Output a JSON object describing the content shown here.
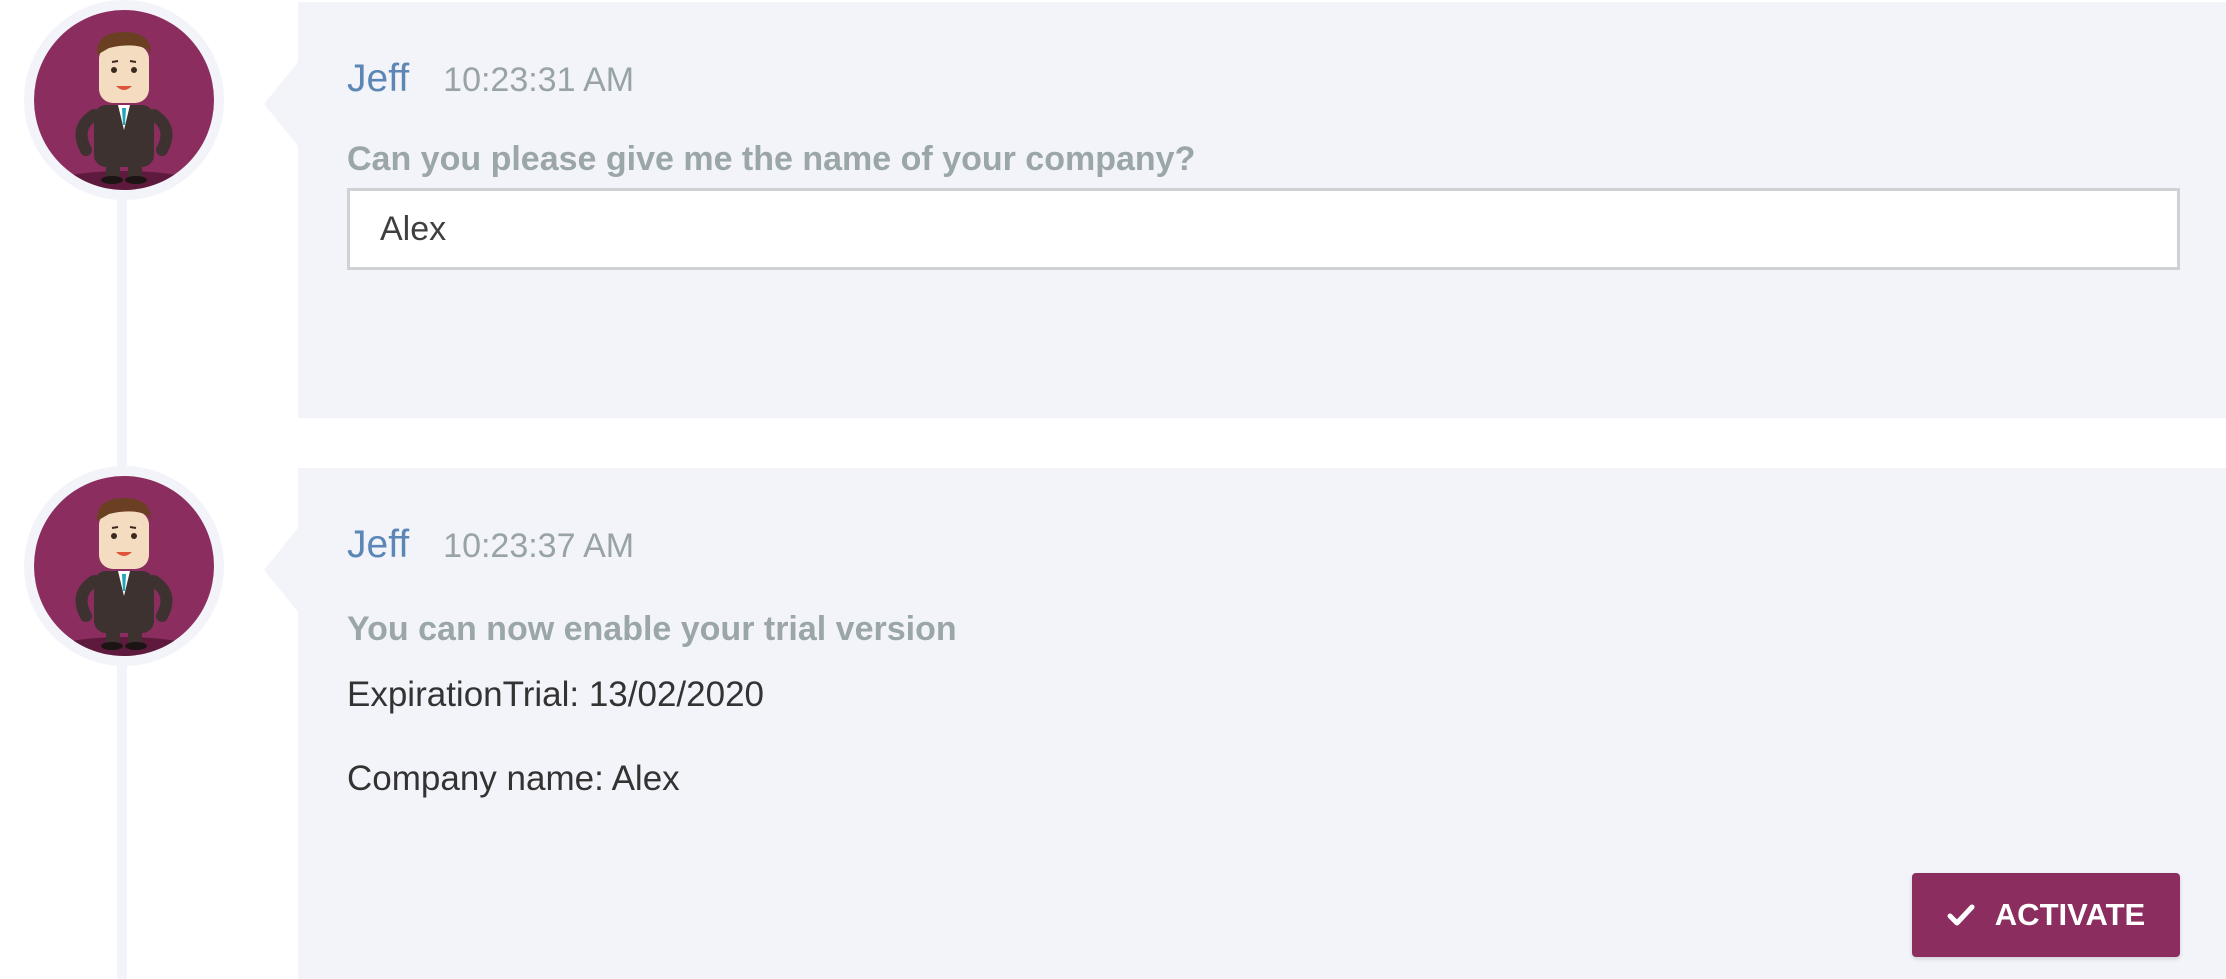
{
  "messages": [
    {
      "sender": "Jeff",
      "time": "10:23:31 AM",
      "question": "Can you please give me the name of your company?",
      "answer_value": "Alex"
    },
    {
      "sender": "Jeff",
      "time": "10:23:37 AM",
      "title": "You can now enable your trial version",
      "expiration": "ExpirationTrial: 13/02/2020",
      "company": "Company name: Alex",
      "button_label": "ACTIVATE",
      "button_icon": "check-icon"
    }
  ],
  "colors": {
    "accent": "#8c2d5f",
    "sender": "#5b86b5",
    "bubble_bg": "#f3f4f9",
    "muted": "#9aa6a7"
  },
  "avatar_icon": "businessman-avatar"
}
